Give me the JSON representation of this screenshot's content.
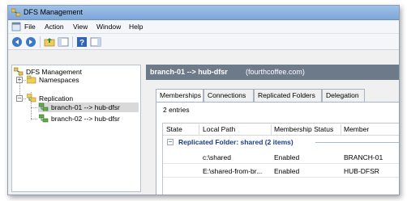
{
  "window": {
    "title": "DFS Management"
  },
  "menu": {
    "items": [
      "File",
      "Action",
      "View",
      "Window",
      "Help"
    ]
  },
  "toolbar": {
    "buttons": [
      "back-icon",
      "forward-icon",
      "up-folder-icon",
      "console-tree-icon",
      "help-icon",
      "show-hide-icon"
    ]
  },
  "tree": {
    "root": "DFS Management",
    "namespaces": "Namespaces",
    "replication": "Replication",
    "groups": [
      "branch-01 --> hub-dfsr",
      "branch-02 --> hub-dfsr"
    ]
  },
  "header": {
    "title": "branch-01 --> hub-dfsr",
    "subtitle": "(fourthcoffee.com)"
  },
  "tabs": [
    "Memberships",
    "Connections",
    "Replicated Folders",
    "Delegation"
  ],
  "entries": "2 entries",
  "columns": [
    "State",
    "Local Path",
    "Membership Status",
    "Member"
  ],
  "group": {
    "label": "Replicated Folder: shared (2 items)"
  },
  "rows": [
    {
      "state": "",
      "local_path": "c:\\shared",
      "status": "Enabled",
      "member": "BRANCH-01"
    },
    {
      "state": "",
      "local_path": "E:\\shared-from-br...",
      "status": "Enabled",
      "member": "HUB-DFSR"
    }
  ],
  "colors": {
    "header_band": "#6d7a8a",
    "group_text": "#1a3c8c",
    "title_bar": "#8fb4e2"
  }
}
